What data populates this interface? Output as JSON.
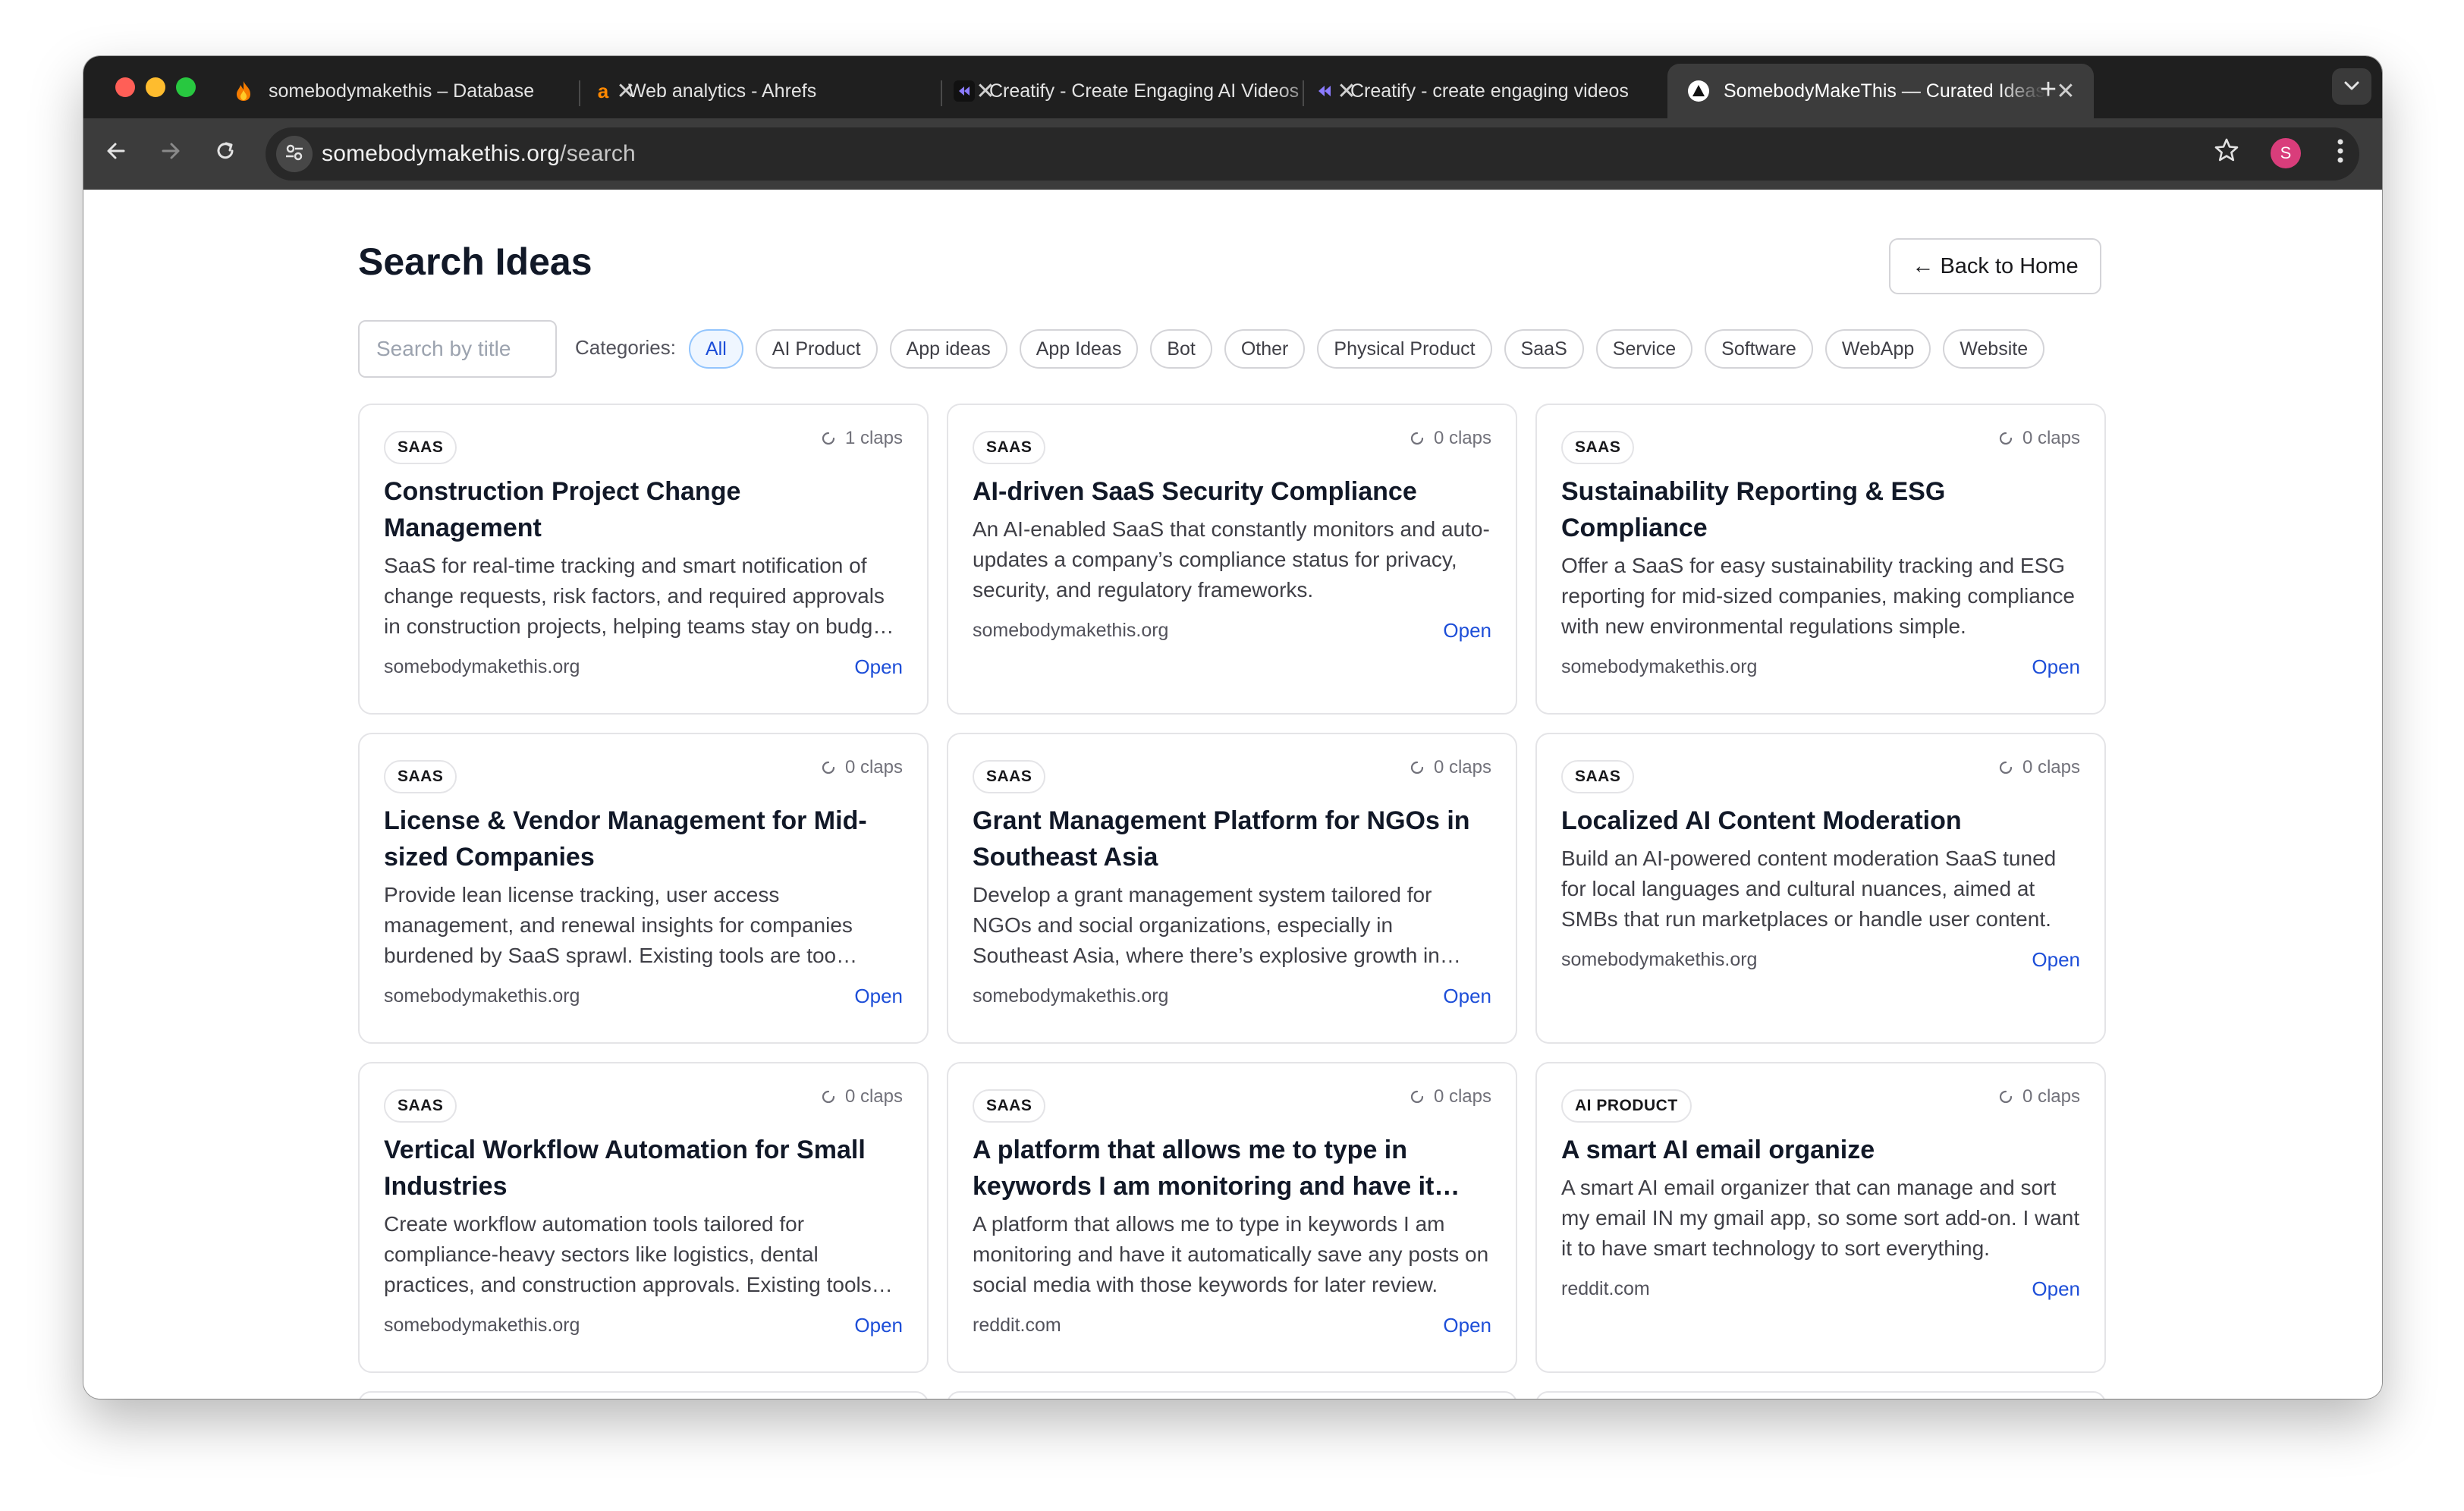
{
  "browser": {
    "tabs": [
      {
        "title": "somebodymakethis – Database",
        "favicon": "flame-icon"
      },
      {
        "title": "Web analytics - Ahrefs",
        "favicon": "ahrefs-a-icon"
      },
      {
        "title": "Creatify - Create Engaging AI Videos",
        "favicon": "creatify-icon"
      },
      {
        "title": "Creatify - create engaging videos",
        "favicon": "creatify-icon"
      },
      {
        "title": "SomebodyMakeThis — Curated Ideas",
        "favicon": "triangle-icon"
      }
    ],
    "active_tab": 4,
    "url_host": "somebodymakethis.org",
    "url_path": "/search",
    "profile_initial": "S",
    "close_glyph": "✕",
    "new_tab_glyph": "+"
  },
  "page": {
    "title": "Search Ideas",
    "back_label": "← Back to Home",
    "search_placeholder": "Search by title",
    "categories_label": "Categories:",
    "categories": [
      "All",
      "AI Product",
      "App ideas",
      "App Ideas",
      "Bot",
      "Other",
      "Physical Product",
      "SaaS",
      "Service",
      "Software",
      "WebApp",
      "Website"
    ],
    "active_category": "All",
    "open_label": "Open"
  },
  "ideas": [
    {
      "badge": "SAAS",
      "claps": "1 claps",
      "title": "Construction Project Change Management",
      "desc": "SaaS for real-time tracking and smart notification of change requests, risk factors, and required approvals in construction projects, helping teams stay on budget and on schedule.",
      "source": "somebodymakethis.org"
    },
    {
      "badge": "SAAS",
      "claps": "0 claps",
      "title": "AI-driven SaaS Security Compliance",
      "desc": "An AI-enabled SaaS that constantly monitors and auto-updates a company’s compliance status for privacy, security, and regulatory frameworks.",
      "source": "somebodymakethis.org"
    },
    {
      "badge": "SAAS",
      "claps": "0 claps",
      "title": "Sustainability Reporting & ESG Compliance",
      "desc": "Offer a SaaS for easy sustainability tracking and ESG reporting for mid-sized companies, making compliance with new environmental regulations simple.",
      "source": "somebodymakethis.org"
    },
    {
      "badge": "SAAS",
      "claps": "0 claps",
      "title": "License & Vendor Management for Mid-sized Companies",
      "desc": "Provide lean license tracking, user access management, and renewal insights for companies burdened by SaaS sprawl. Existing tools are too complex.",
      "source": "somebodymakethis.org"
    },
    {
      "badge": "SAAS",
      "claps": "0 claps",
      "title": "Grant Management Platform for NGOs in Southeast Asia",
      "desc": "Develop a grant management system tailored for NGOs and social organizations, especially in Southeast Asia, where there’s explosive growth in funding.",
      "source": "somebodymakethis.org"
    },
    {
      "badge": "SAAS",
      "claps": "0 claps",
      "title": "Localized AI Content Moderation",
      "desc": "Build an AI-powered content moderation SaaS tuned for local languages and cultural nuances, aimed at SMBs that run marketplaces or handle user content.",
      "source": "somebodymakethis.org"
    },
    {
      "badge": "SAAS",
      "claps": "0 claps",
      "title": "Vertical Workflow Automation for Small Industries",
      "desc": "Create workflow automation tools tailored for compliance-heavy sectors like logistics, dental practices, and construction approvals. Existing tools are generic.",
      "source": "somebodymakethis.org"
    },
    {
      "badge": "SAAS",
      "claps": "0 claps",
      "title": "A platform that allows me to type in keywords I am monitoring and have it automatically save posts",
      "desc": "A platform that allows me to type in keywords I am monitoring and have it automatically save any posts on social media with those keywords for later review.",
      "source": "reddit.com"
    },
    {
      "badge": "AI PRODUCT",
      "claps": "0 claps",
      "title": "A smart AI email organize",
      "desc": "A smart AI email organizer that can manage and sort my email IN my gmail app, so some sort add-on. I want it to have smart technology to sort everything.",
      "source": "reddit.com"
    }
  ]
}
